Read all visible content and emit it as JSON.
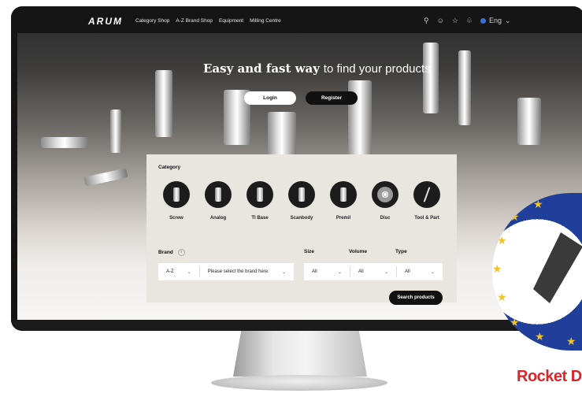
{
  "nav": {
    "logo": "ARUM",
    "menu": [
      "Category Shop",
      "A-Z Brand Shop",
      "Equipment",
      "Milling Centre"
    ],
    "language": "Eng",
    "icons": [
      "search-icon",
      "user-icon",
      "star-icon",
      "cart-icon",
      "globe-icon"
    ]
  },
  "hero": {
    "title_bold": "Easy and fast way",
    "title_rest": "to find your products",
    "login_label": "Login",
    "register_label": "Register"
  },
  "search": {
    "category_label": "Category",
    "categories": [
      {
        "label": "Screw",
        "icon": "screw-icon"
      },
      {
        "label": "Analog",
        "icon": "analog-icon"
      },
      {
        "label": "TI Base",
        "icon": "ti-base-icon"
      },
      {
        "label": "Scanbody",
        "icon": "scanbody-icon"
      },
      {
        "label": "Premil",
        "icon": "premil-icon"
      },
      {
        "label": "Disc",
        "icon": "disc-icon"
      },
      {
        "label": "Tool & Part",
        "icon": "tool-icon"
      }
    ],
    "brand_label": "Brand",
    "brand_az": "A-Z",
    "brand_placeholder": "Please select the brand here.",
    "size_label": "Size",
    "size_value": "All",
    "volume_label": "Volume",
    "volume_value": "All",
    "type_label": "Type",
    "type_value": "All",
    "search_button": "Search products"
  },
  "badge": {
    "text": "Rocket D"
  },
  "colors": {
    "nav_bg": "#151516",
    "panel_bg": "#e9e5df",
    "badge_blue": "#1f3f9a",
    "badge_red": "#d8262a",
    "star_yellow": "#f7c21a"
  }
}
